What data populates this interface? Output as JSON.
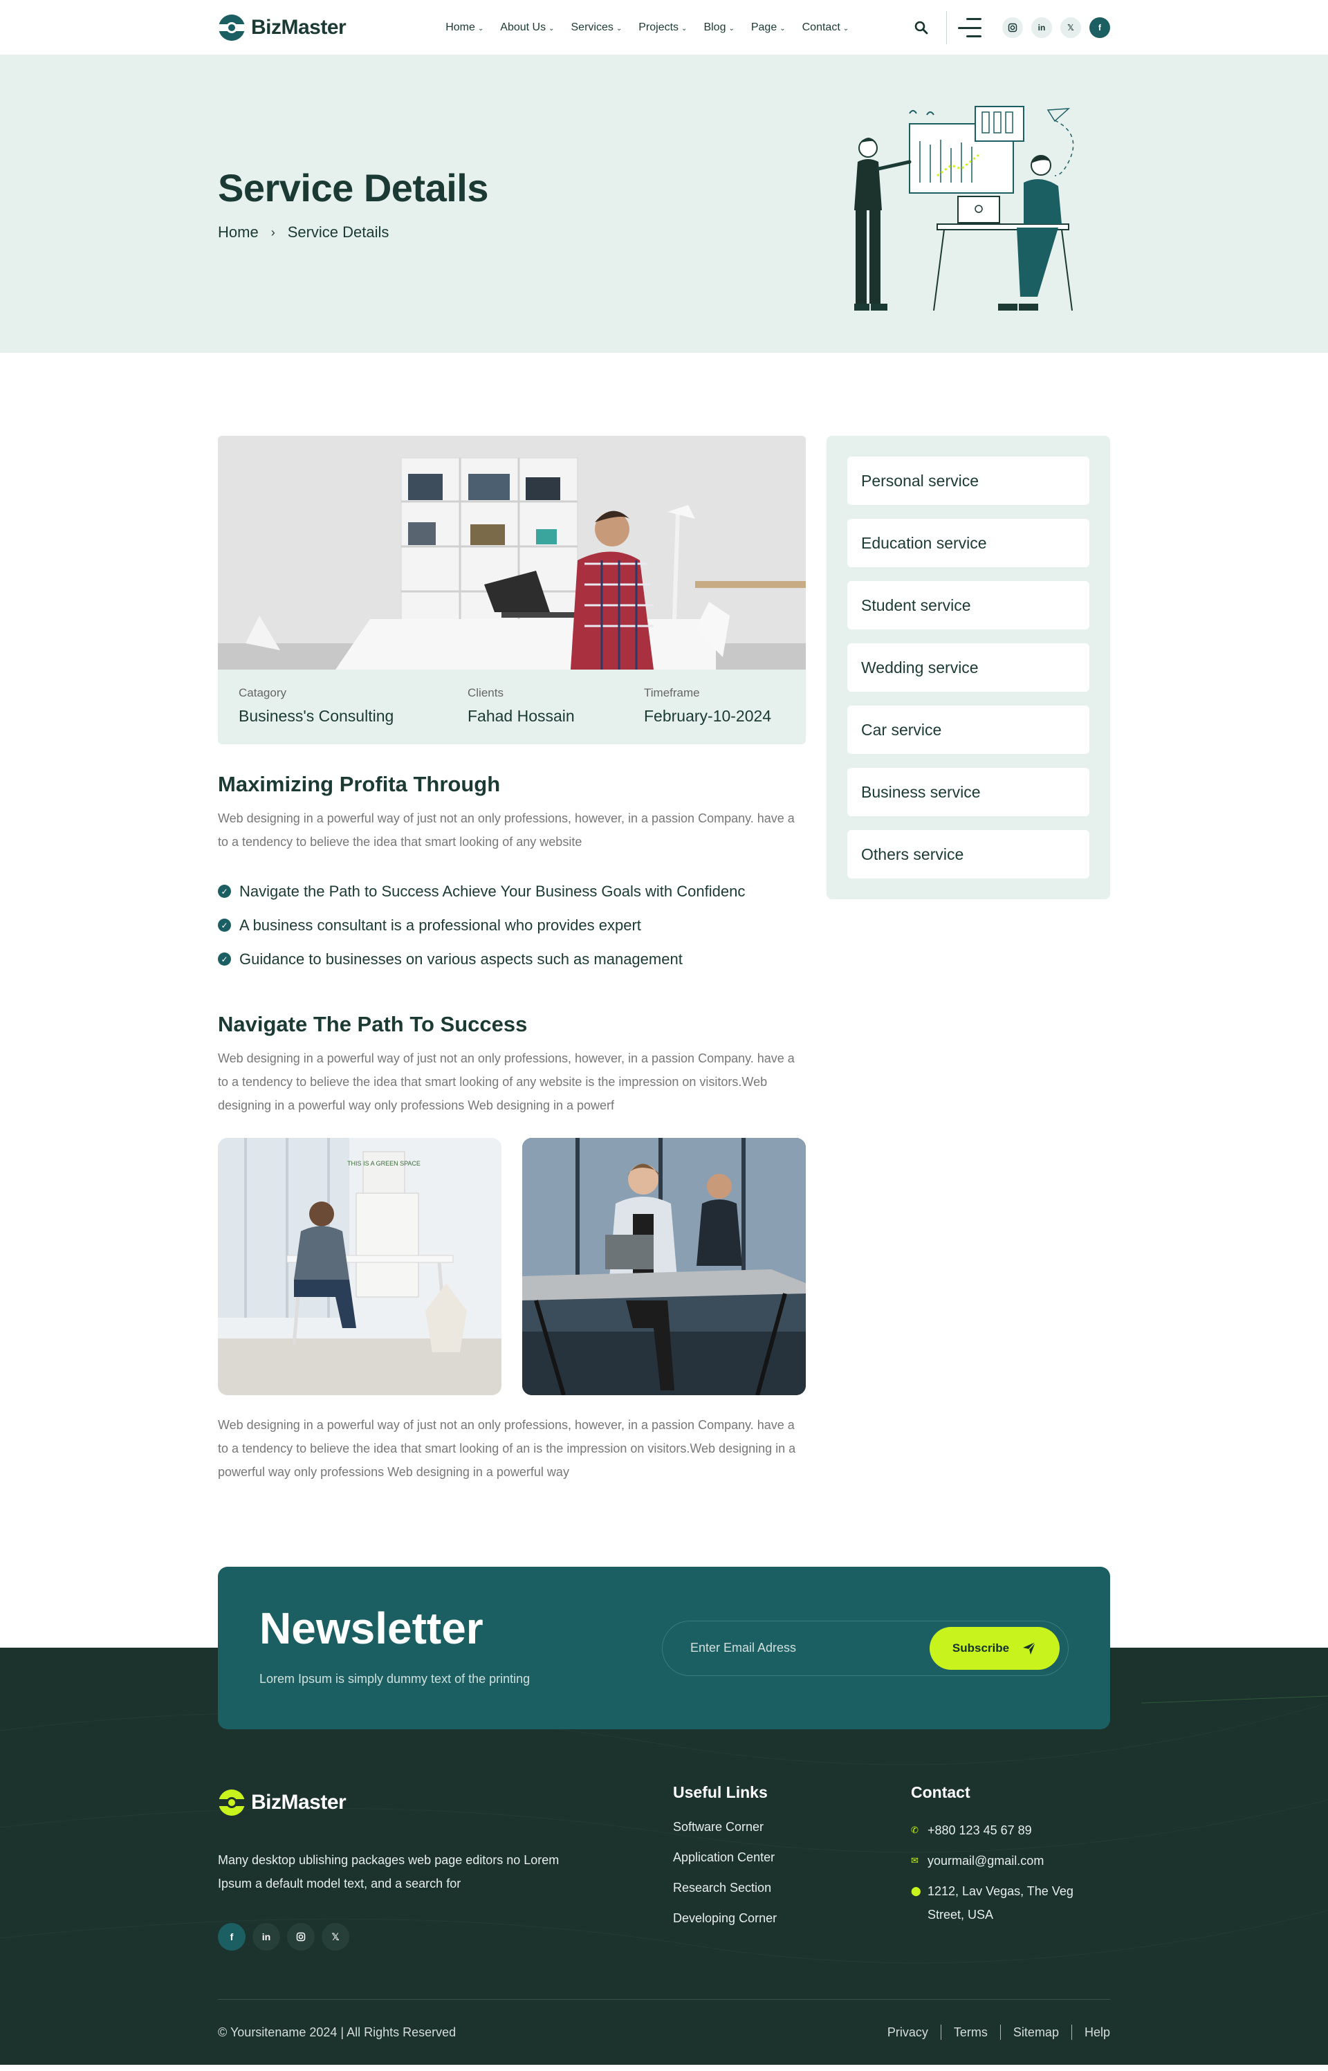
{
  "brand": {
    "name": "BizMaster",
    "accent": "#1c5f63",
    "lime": "#c9f31d",
    "dark": "#1b322d"
  },
  "nav": [
    {
      "label": "Home"
    },
    {
      "label": "About Us"
    },
    {
      "label": "Services"
    },
    {
      "label": "Projects"
    },
    {
      "label": "Blog"
    },
    {
      "label": "Page"
    },
    {
      "label": "Contact"
    }
  ],
  "header_social": [
    "instagram-icon",
    "linkedin-icon",
    "x-icon",
    "facebook-icon"
  ],
  "hero": {
    "title": "Service Details",
    "breadcrumb": [
      "Home",
      "Service Details"
    ]
  },
  "meta": [
    {
      "label": "Catagory",
      "value": "Business's Consulting"
    },
    {
      "label": "Clients",
      "value": "Fahad Hossain"
    },
    {
      "label": "Timeframe",
      "value": "February-10-2024"
    }
  ],
  "section1": {
    "heading": "Maximizing Profita Through",
    "text": "Web designing in a powerful way of just not an only professions, however, in a passion  Company. have a to a tendency to believe the idea that smart looking of any website",
    "checklist": [
      "Navigate the Path to Success Achieve Your Business Goals with Confidenc",
      "A business consultant is a professional who provides expert",
      "Guidance to businesses on various aspects such as management"
    ]
  },
  "section2": {
    "heading": "Navigate The Path To Success",
    "text": "Web designing in a powerful way of just not an only professions, however, in a passion  Company. have a to a tendency to believe the idea that smart looking of any website is the  impression on visitors.Web designing in a powerful way only professions Web designing in a powerf",
    "text2": "Web designing in a powerful way of just not an only professions, however, in a passion  Company. have a to a tendency to believe the idea that smart looking of an is the  impression on visitors.Web designing in a powerful way only professions Web designing in a powerful way"
  },
  "photo_sign": "THIS IS A GREEN SPACE",
  "services": [
    "Personal service",
    "Education service",
    "Student service",
    "Wedding service",
    "Car service",
    "Business service",
    "Others service"
  ],
  "newsletter": {
    "title": "Newsletter",
    "subtitle": "Lorem Ipsum is simply dummy text of the printing",
    "placeholder": "Enter Email Adress",
    "button": "Subscribe"
  },
  "footer": {
    "about": "Many desktop ublishing packages web page editors no Lorem Ipsum a default model text, and a search for",
    "useful_title": "Useful Links",
    "useful_links": [
      "Software Corner",
      "Application Center",
      "Research Section",
      "Developing Corner"
    ],
    "contact_title": "Contact",
    "phone": "+880 123 45 67 89",
    "email": "yourmail@gmail.com",
    "address": "1212, Lav Vegas, The Veg Street, USA",
    "copyright": "© Yoursitename  2024 | All Rights Reserved",
    "bottom_links": [
      "Privacy",
      "Terms",
      "Sitemap",
      "Help"
    ]
  }
}
